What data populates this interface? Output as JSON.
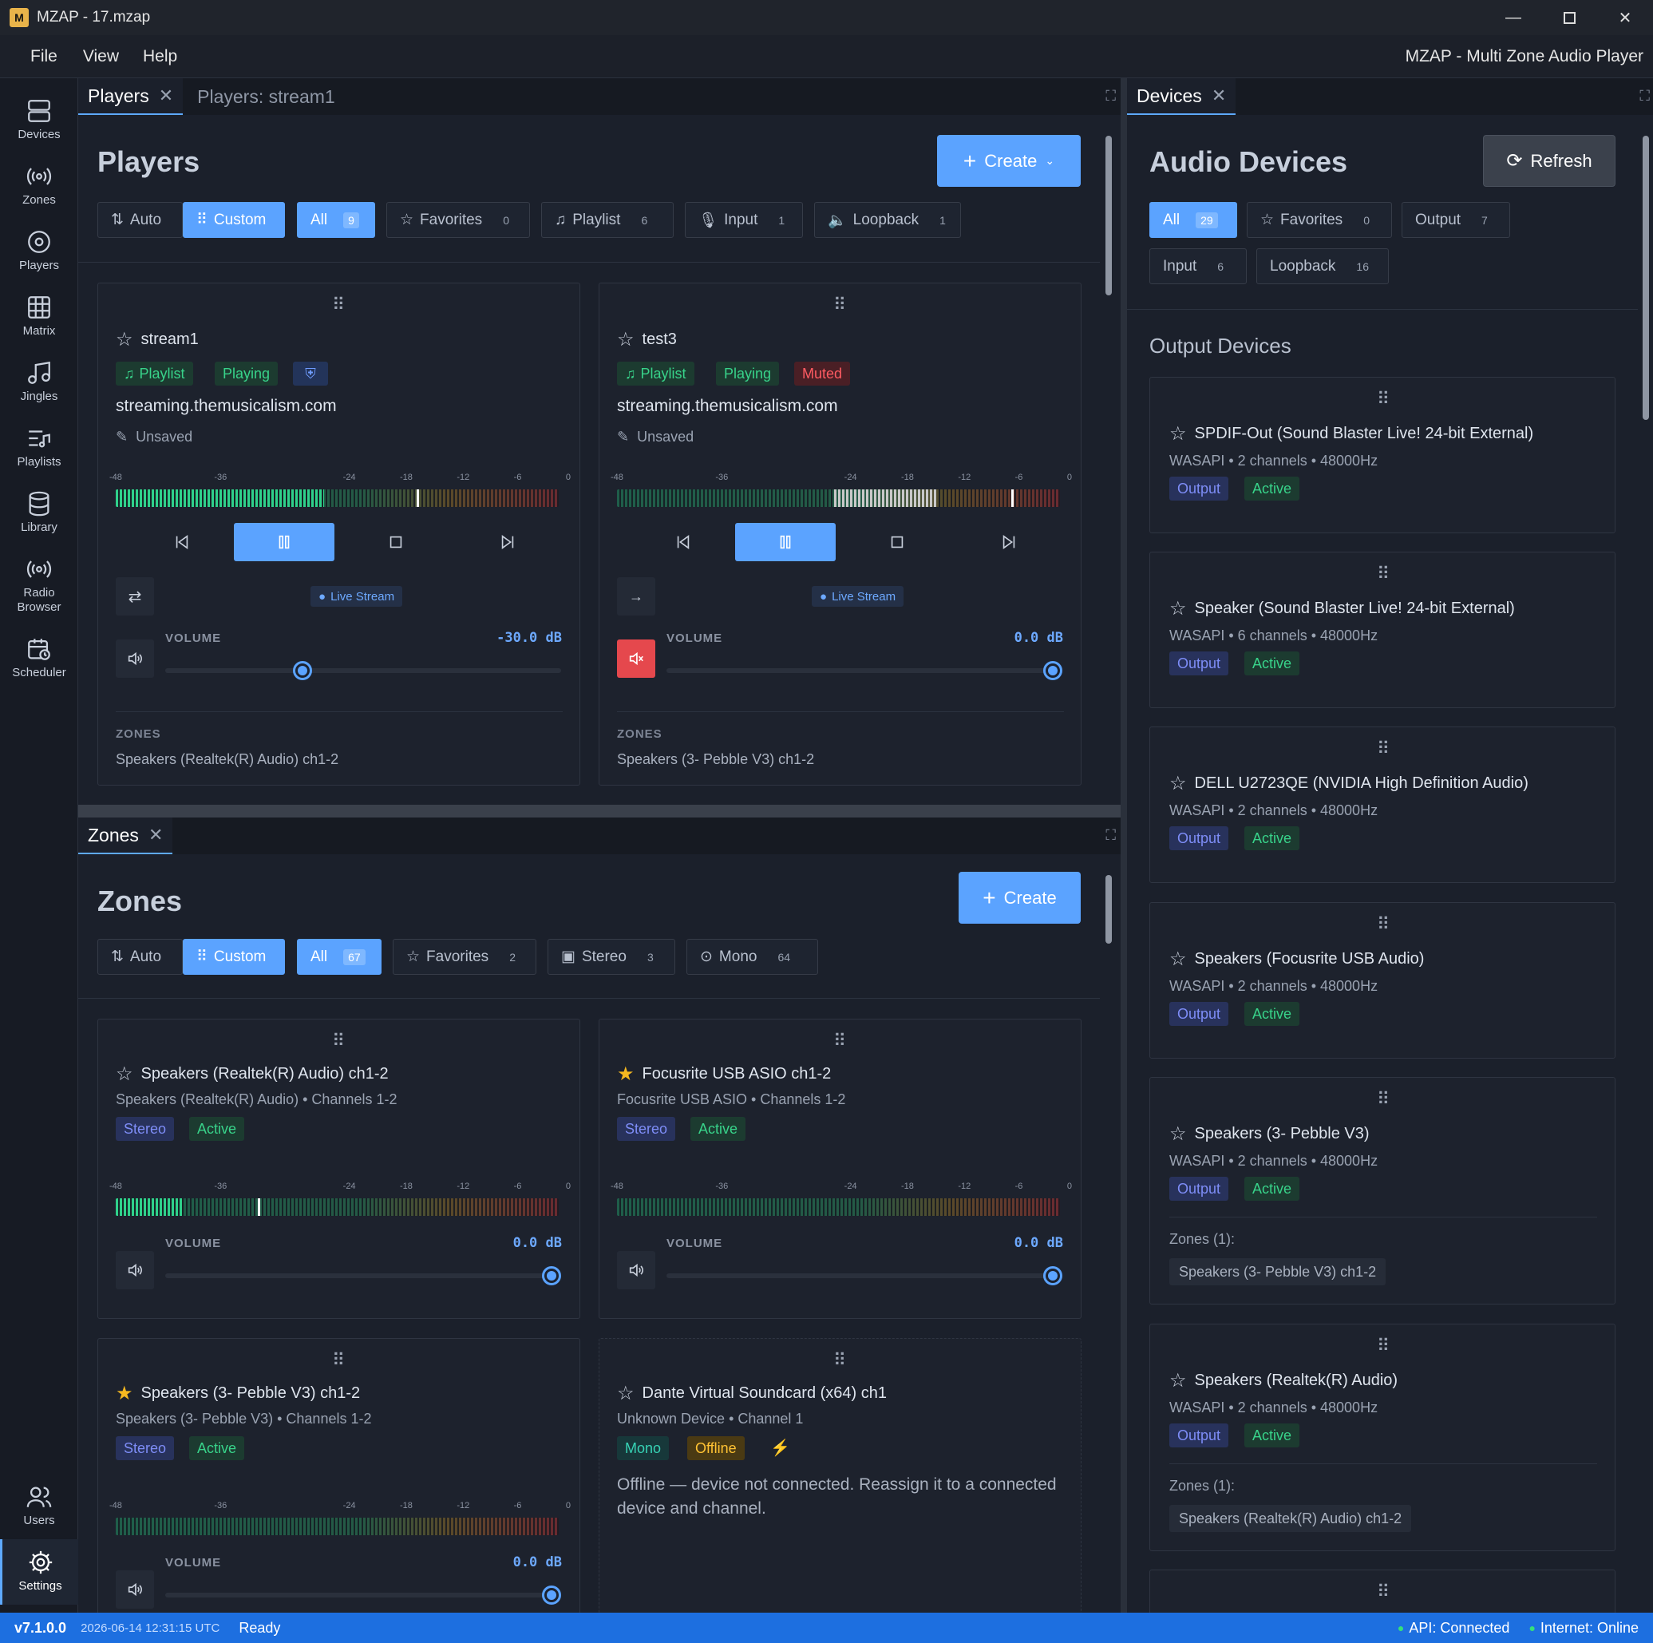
{
  "window": {
    "title": "MZAP - 17.mzap",
    "app_title": "MZAP - Multi Zone Audio Player",
    "logo": "M"
  },
  "menu": [
    "File",
    "View",
    "Help"
  ],
  "rail": [
    {
      "label": "Devices",
      "icon": "server-icon"
    },
    {
      "label": "Zones",
      "icon": "broadcast-icon"
    },
    {
      "label": "Players",
      "icon": "disc-icon"
    },
    {
      "label": "Matrix",
      "icon": "grid-icon"
    },
    {
      "label": "Jingles",
      "icon": "music-note-icon"
    },
    {
      "label": "Playlists",
      "icon": "playlist-icon"
    },
    {
      "label": "Library",
      "icon": "database-icon"
    },
    {
      "label": "Radio Browser",
      "icon": "radio-icon"
    },
    {
      "label": "Scheduler",
      "icon": "calendar-clock-icon"
    },
    {
      "label": "Users",
      "icon": "users-icon"
    },
    {
      "label": "Settings",
      "icon": "gear-icon"
    }
  ],
  "players_panel": {
    "tabs": [
      "Players",
      "Players: stream1"
    ],
    "title": "Players",
    "create": "Create",
    "sort": [
      "Auto",
      "Custom"
    ],
    "filters": [
      {
        "label": "All",
        "count": "9"
      },
      {
        "label": "Favorites",
        "count": "0"
      },
      {
        "label": "Playlist",
        "count": "6"
      },
      {
        "label": "Input",
        "count": "1"
      },
      {
        "label": "Loopback",
        "count": "1"
      }
    ],
    "scale": [
      "-48",
      "-36",
      "-24",
      "-18",
      "-12",
      "-6",
      "0"
    ],
    "cards": [
      {
        "name": "stream1",
        "b1": "Playlist",
        "b2": "Playing",
        "url": "streaming.themusicalism.com",
        "saved": "Unsaved",
        "live": "Live Stream",
        "vol_label": "VOLUME",
        "vol": "-30.0 dB",
        "volume_frac": 0.34,
        "level": 0.47,
        "peak": 0.68,
        "zones_label": "ZONES",
        "zones": "Speakers (Realtek(R) Audio) ch1-2"
      },
      {
        "name": "test3",
        "b1": "Playlist",
        "b2": "Playing",
        "b3": "Muted",
        "url": "streaming.themusicalism.com",
        "saved": "Unsaved",
        "live": "Live Stream",
        "vol_label": "VOLUME",
        "vol": "0.0 dB",
        "volume_frac": 1.0,
        "level": 0.72,
        "peak": 0.89,
        "zones_label": "ZONES",
        "zones": "Speakers (3- Pebble V3) ch1-2"
      }
    ]
  },
  "zones_panel": {
    "tab": "Zones",
    "title": "Zones",
    "create": "Create",
    "sort": [
      "Auto",
      "Custom"
    ],
    "filters": [
      {
        "label": "All",
        "count": "67"
      },
      {
        "label": "Favorites",
        "count": "2"
      },
      {
        "label": "Stereo",
        "count": "3"
      },
      {
        "label": "Mono",
        "count": "64"
      }
    ],
    "cards": [
      {
        "name": "Speakers (Realtek(R) Audio) ch1-2",
        "sub": "Speakers (Realtek(R) Audio) • Channels 1-2",
        "b1": "Stereo",
        "b2": "Active",
        "fav": false,
        "vol_label": "VOLUME",
        "vol": "0.0 dB",
        "level": 0.15,
        "peak": 0.32
      },
      {
        "name": "Focusrite USB ASIO ch1-2",
        "sub": "Focusrite USB ASIO • Channels 1-2",
        "b1": "Stereo",
        "b2": "Active",
        "fav": true,
        "vol_label": "VOLUME",
        "vol": "0.0 dB",
        "level": 0,
        "peak": 0
      },
      {
        "name": "Speakers (3- Pebble V3) ch1-2",
        "sub": "Speakers (3- Pebble V3) • Channels 1-2",
        "b1": "Stereo",
        "b2": "Active",
        "fav": true,
        "vol_label": "VOLUME",
        "vol": "0.0 dB",
        "level": 0,
        "peak": 0
      },
      {
        "name": "Dante Virtual Soundcard (x64) ch1",
        "sub": "Unknown Device • Channel 1",
        "b1": "Mono",
        "b2": "Offline",
        "msg": "Offline — device not connected. Reassign it to a connected device and channel.",
        "fav": false
      }
    ]
  },
  "devices_panel": {
    "tab": "Devices",
    "title": "Audio Devices",
    "refresh": "Refresh",
    "filters": [
      {
        "label": "All",
        "count": "29"
      },
      {
        "label": "Favorites",
        "count": "0"
      },
      {
        "label": "Output",
        "count": "7"
      },
      {
        "label": "Input",
        "count": "6"
      },
      {
        "label": "Loopback",
        "count": "16"
      }
    ],
    "section": "Output Devices",
    "devices": [
      {
        "name": "SPDIF-Out (Sound Blaster Live! 24-bit External)",
        "sub": "WASAPI • 2 channels • 48000Hz",
        "b1": "Output",
        "b2": "Active"
      },
      {
        "name": "Speaker (Sound Blaster Live! 24-bit External)",
        "sub": "WASAPI • 6 channels • 48000Hz",
        "b1": "Output",
        "b2": "Active"
      },
      {
        "name": "DELL U2723QE (NVIDIA High Definition Audio)",
        "sub": "WASAPI • 2 channels • 48000Hz",
        "b1": "Output",
        "b2": "Active"
      },
      {
        "name": "Speakers (Focusrite USB Audio)",
        "sub": "WASAPI • 2 channels • 48000Hz",
        "b1": "Output",
        "b2": "Active"
      },
      {
        "name": "Speakers (3- Pebble V3)",
        "sub": "WASAPI • 2 channels • 48000Hz",
        "b1": "Output",
        "b2": "Active",
        "zones_label": "Zones (1):",
        "zone": "Speakers (3- Pebble V3) ch1-2"
      },
      {
        "name": "Speakers (Realtek(R) Audio)",
        "sub": "WASAPI • 2 channels • 48000Hz",
        "b1": "Output",
        "b2": "Active",
        "zones_label": "Zones (1):",
        "zone": "Speakers (Realtek(R) Audio) ch1-2"
      }
    ]
  },
  "status": {
    "version": "v7.1.0.0",
    "time": "2026-06-14 12:31:15 UTC",
    "state": "Ready",
    "api": "API: Connected",
    "internet": "Internet: Online"
  },
  "colors": {
    "accent": "#5ba3ff",
    "active": "#38d38a",
    "muted": "#ff5b62",
    "offline": "#ffc233",
    "statusbar": "#1d6fe0"
  }
}
